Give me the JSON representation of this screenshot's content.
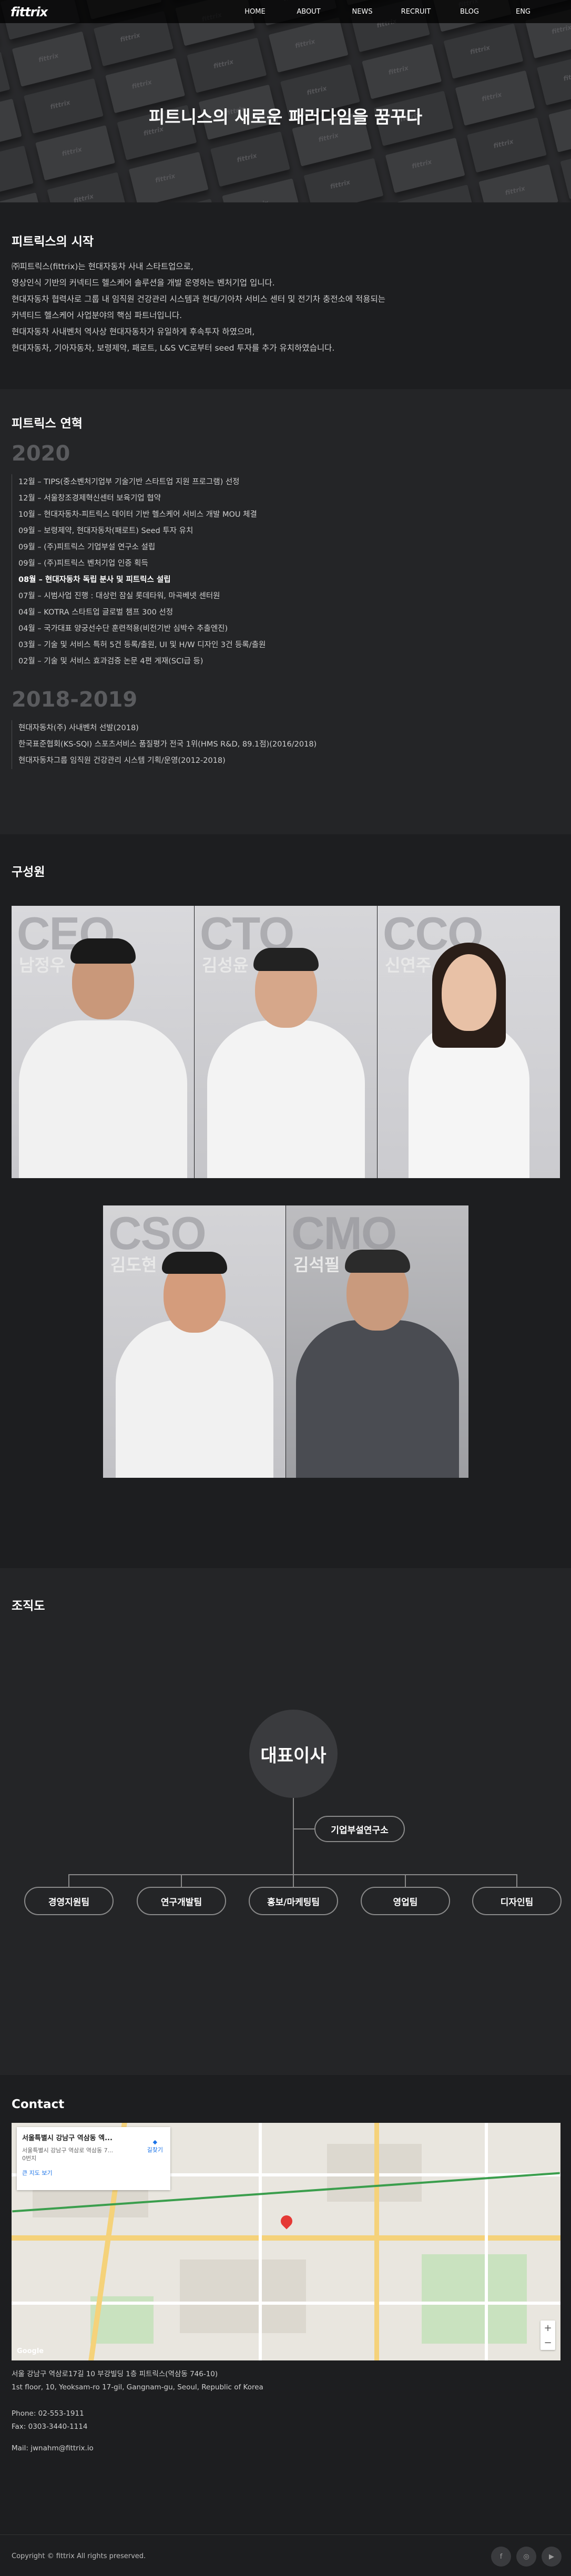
{
  "header": {
    "logo": "fittrix",
    "nav": [
      "HOME",
      "ABOUT",
      "NEWS",
      "RECRUIT",
      "BLOG",
      "ENG"
    ],
    "hero_title": "피트니스의 새로운 패러다임을 꿈꾸다"
  },
  "start": {
    "title": "피트릭스의 시작",
    "lines": [
      "㈜피트릭스(fittrix)는 현대자동차 사내 스타트업으로,",
      "영상인식 기반의 커넥티드 헬스케어 솔루션을 개발 운영하는 벤처기업 입니다.",
      "현대자동차 협력사로 그룹 내 임직원 건강관리 시스템과 현대/기아차 서비스 센터 및 전기차 충전소에 적용되는",
      "커넥티드 헬스케어 사업분야의 핵심 파트너입니다.",
      "현대자동차 사내벤처 역사상 현대자동차가 유일하게 후속투자 하였으며,",
      "현대자동차, 기아자동차, 보령제약, 패로트, L&S VC로부터 seed 투자를 추가 유치하였습니다."
    ]
  },
  "history": {
    "title": "피트릭스 연혁",
    "groups": [
      {
        "year": "2020",
        "items": [
          "12월 – TIPS(중소벤처기업부 기술기반 스타트업 지원 프로그램) 선정",
          "12월 – 서울창조경제혁신센터 보육기업 협약",
          "10월 – 현대자동차-피트릭스 데이터 기반 헬스케어 서비스 개발 MOU 체결",
          "09월 – 보령제약, 현대자동차(패로트) Seed 투자 유치",
          "09월 – (주)피트릭스 기업부설 연구소 설립",
          "09월 – (주)피트릭스 벤처기업 인증 획득",
          "08월 – 현대자동차 독립 분사 및 피트릭스 설립",
          "07월 – 시범사업 진행 : 대상런 잠실 롯데타워, 마곡베넷 센터원",
          "04월 – KOTRA 스타트업 글로벌 챔프 300 선정",
          "04월 – 국가대표 양궁선수단 훈련적용(비전기반 심박수 추출엔진)",
          "03월 – 기술 및 서비스 특허 5건 등록/출원, UI 및 H/W 디자인 3건 등록/출원",
          "02월 – 기술 및 서비스 효과검증 논문 4편 게재(SCI급 등)"
        ],
        "highlight_index": 6
      },
      {
        "year": "2018-2019",
        "items": [
          "현대자동차(주) 사내벤처 선발(2018)",
          "한국표준협회(KS-SQI) 스포츠서비스 품질평가 전국 1위(HMS R&D, 89.1점)(2016/2018)",
          "현대자동차그룹 임직원 건강관리 시스템 기획/운영(2012-2018)"
        ]
      }
    ]
  },
  "members": {
    "title": "구성원",
    "people": [
      {
        "role": "CEO",
        "name": "남정우"
      },
      {
        "role": "CTO",
        "name": "김성윤"
      },
      {
        "role": "CCO",
        "name": "신연주"
      },
      {
        "role": "CSO",
        "name": "김도현"
      },
      {
        "role": "CMO",
        "name": "김석필"
      }
    ]
  },
  "org": {
    "title": "조직도",
    "ceo": "대표이사",
    "lab": "기업부설연구소",
    "depts": [
      "경영지원팀",
      "연구개발팀",
      "홍보/마케팅팀",
      "영업팀",
      "디자인팀"
    ]
  },
  "contact": {
    "title": "Contact",
    "map": {
      "place_title": "서울특별시 강남구 역삼동 엑...",
      "place_sub": "서울특별시 강남구 역삼로 역삼동 7...",
      "place_sub2": "0번지",
      "directions": "길찾기",
      "bigger_map": "큰 지도 보기",
      "zoom_in": "+",
      "zoom_out": "−",
      "google": "Google"
    },
    "address_lines": [
      "서울 강남구 역삼로17길 10 부강빌딩 1층 피트릭스(역삼동 746-10)",
      "1st floor, 10, Yeoksam-ro 17-gil, Gangnam-gu, Seoul, Republic of Korea"
    ],
    "phone": "Phone: 02-553-1911",
    "fax": "Fax: 0303-3440-1114",
    "mail": "Mail: jwnahm@fittrix.io"
  },
  "footer": {
    "copyright": "Copyright © fittrix All rights preserved.",
    "socials": [
      "f",
      "◎",
      "▶"
    ]
  },
  "colors": {
    "background": "#1d1e20",
    "section_alt": "#242527",
    "text": "#d8d8d8",
    "accent_pin": "#e53935"
  }
}
